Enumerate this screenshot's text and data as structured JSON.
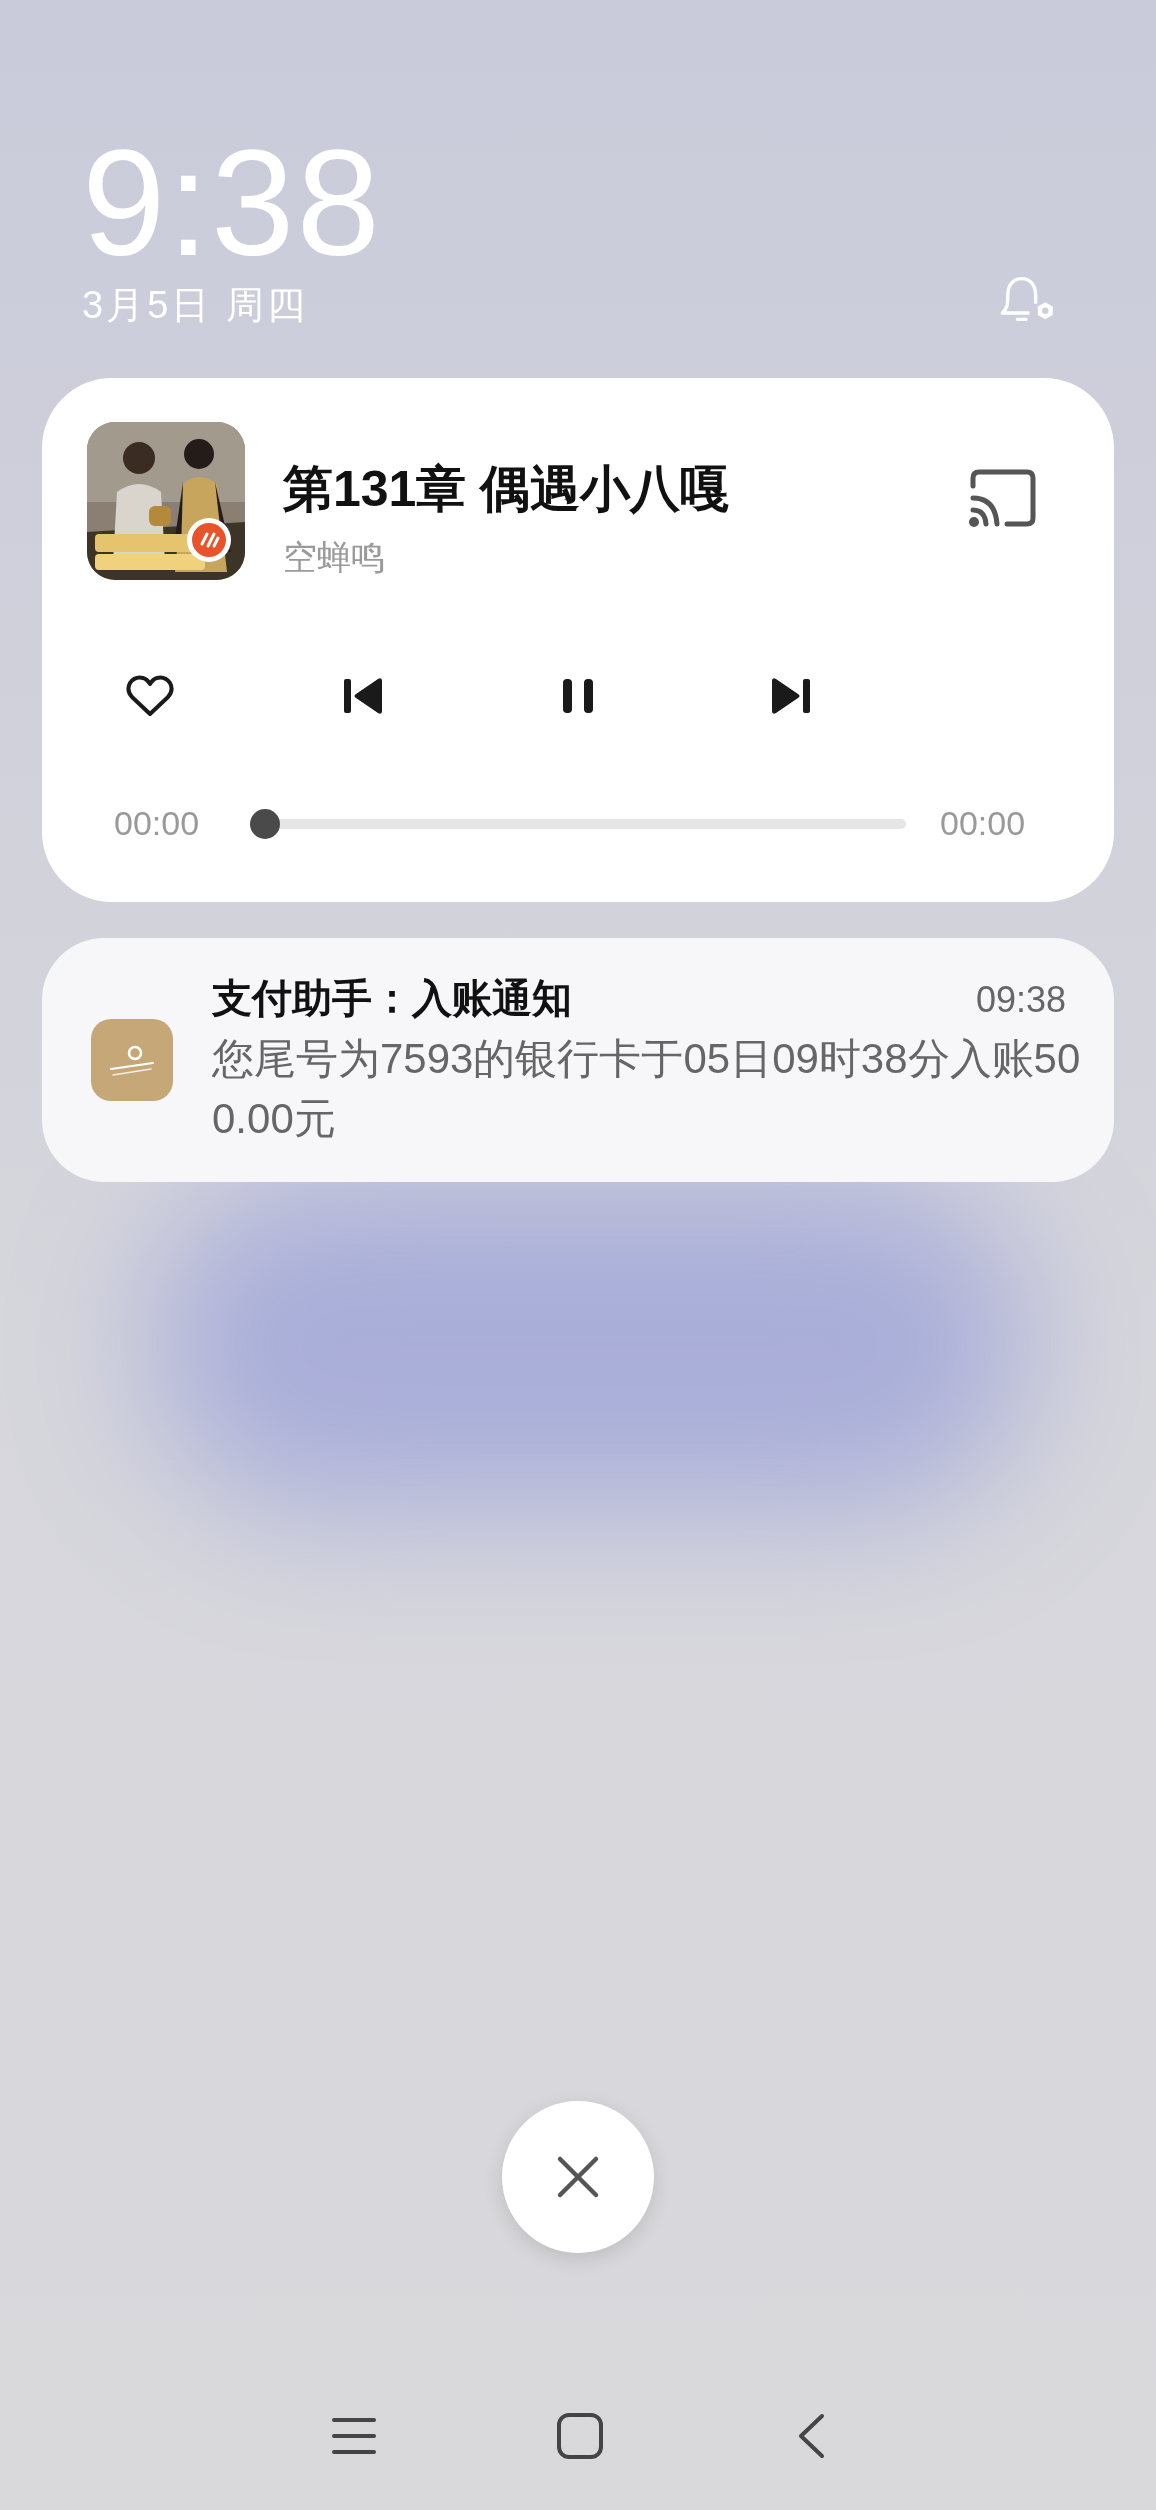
{
  "lock_screen": {
    "time": "9:38",
    "date": "3月5日 周四"
  },
  "media_player": {
    "title": "第131章 偶遇小八嘎",
    "artist": "空蝉鸣",
    "liked": false,
    "playing": true,
    "elapsed": "00:00",
    "duration": "00:00",
    "level": 0
  },
  "notification": {
    "title": "支付助手：入账通知",
    "time": "09:38",
    "body": "您尾号为7593的银行卡于05日09时38分入账500.00元"
  }
}
